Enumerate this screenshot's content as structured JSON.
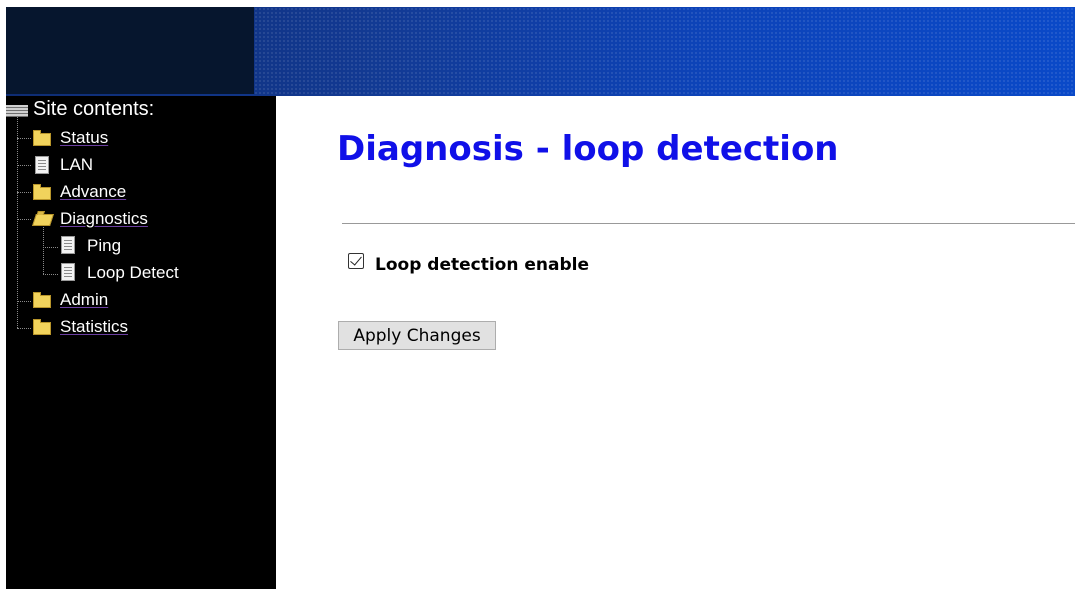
{
  "banner": {
    "colors": {
      "logo_bg": "#06162e",
      "gradient_start": "#0e2c72",
      "gradient_end": "#0a49c8"
    }
  },
  "sidebar": {
    "root_label": "Site contents:",
    "root_icon": "tree-root-icon",
    "items": [
      {
        "label": "Status",
        "icon": "folder-icon",
        "link": true
      },
      {
        "label": "LAN",
        "icon": "document-icon",
        "link": false
      },
      {
        "label": "Advance",
        "icon": "folder-icon",
        "link": true
      },
      {
        "label": "Diagnostics",
        "icon": "folder-open-icon",
        "link": true,
        "children": [
          {
            "label": "Ping",
            "icon": "document-icon",
            "link": false
          },
          {
            "label": "Loop Detect",
            "icon": "document-icon",
            "link": false
          }
        ]
      },
      {
        "label": "Admin",
        "icon": "folder-icon",
        "link": true
      },
      {
        "label": "Statistics",
        "icon": "folder-icon",
        "link": true
      }
    ]
  },
  "main": {
    "title": "Diagnosis - loop detection",
    "checkbox": {
      "label": "Loop detection enable",
      "checked": true
    },
    "apply_button": "Apply Changes"
  },
  "colors": {
    "title": "#1010e8",
    "sidebar_bg": "#000000",
    "link_underline": "#6b3fa0"
  }
}
